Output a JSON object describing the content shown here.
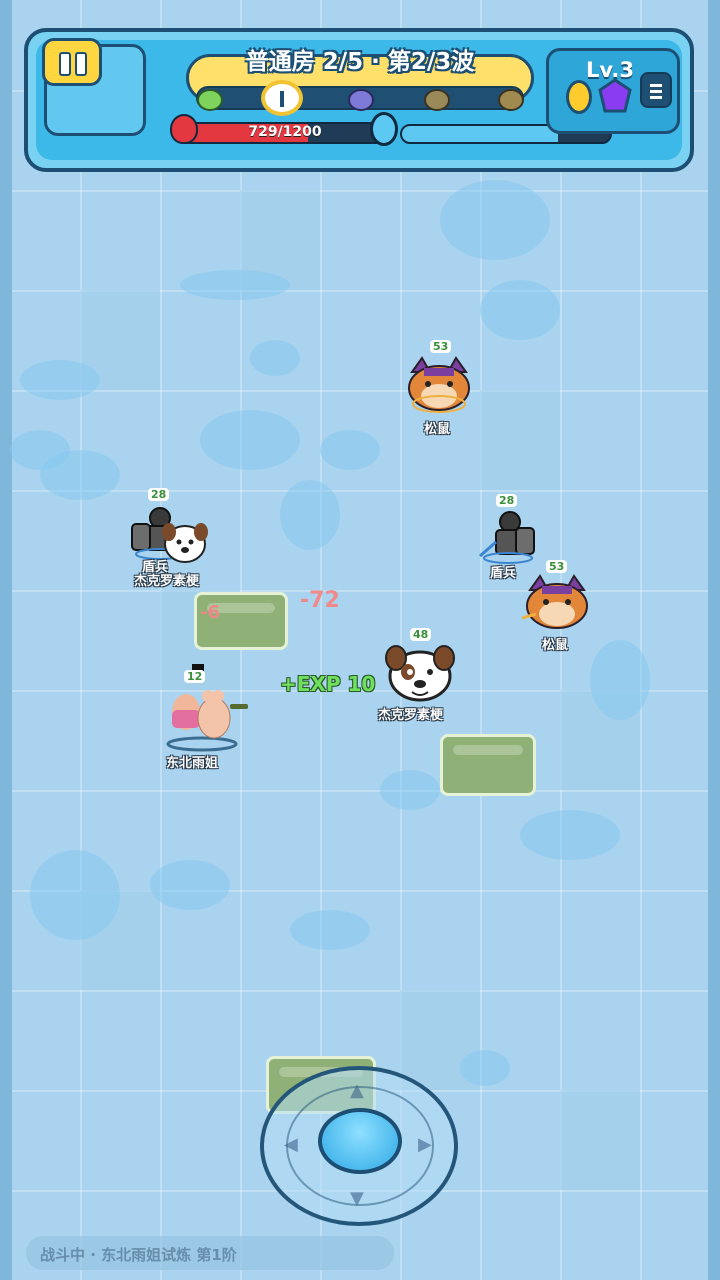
{
  "hud": {
    "title": "普通房 2/5 · 第2/3波",
    "hp_text": "729/1200",
    "hp_fraction": 0.6075,
    "mp_fraction": 0.75,
    "level_text": "Lv.3",
    "colors": {
      "hp": "#e3383f",
      "mp": "#5dc8f2",
      "banner": "#ffe06a",
      "frame": "#1c4f73"
    },
    "icons": [
      "pause-icon",
      "heart-icon",
      "mana-drop-icon",
      "coin-icon",
      "gem-icon",
      "menu-icon"
    ]
  },
  "wave_nodes": [
    "leaf-icon",
    "current-wave-icon",
    "skull-icon",
    "boss-icon",
    "chest-icon"
  ],
  "enemies": [
    {
      "name": "松鼠",
      "level": "53",
      "kind": "squirrel-enemy"
    },
    {
      "name": "盾兵",
      "level": "28",
      "kind": "shield-soldier-enemy"
    },
    {
      "name": "盾兵",
      "level": "28",
      "kind": "shield-soldier-enemy"
    },
    {
      "name": "杰克罗素梗",
      "level": "28",
      "kind": "terrier-enemy"
    },
    {
      "name": "松鼠",
      "level": "53",
      "kind": "squirrel-enemy"
    },
    {
      "name": "杰克罗素梗",
      "level": "48",
      "kind": "terrier-enemy"
    }
  ],
  "player": {
    "name": "东北雨姐",
    "level": "12"
  },
  "floating_text": {
    "damage_1": "-72",
    "damage_2": "-6",
    "exp": "+EXP 10"
  },
  "status": {
    "text": "战斗中 · 东北雨姐试炼 第1阶"
  }
}
